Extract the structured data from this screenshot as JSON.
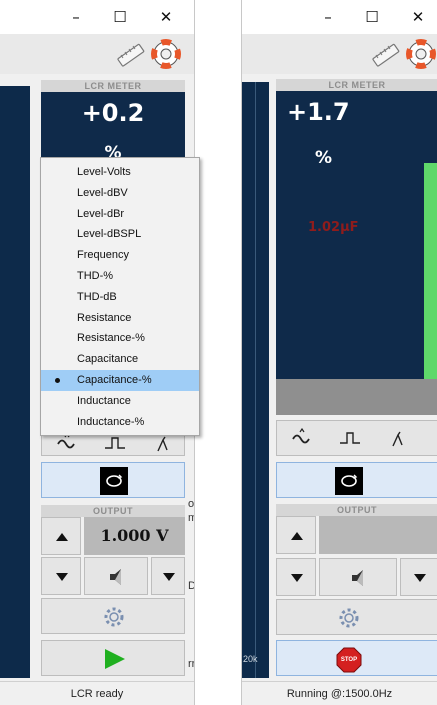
{
  "left_window": {
    "titlebar": {
      "minimize": "–",
      "maximize": "☐",
      "close": "✕"
    },
    "lcr": {
      "header": "LCR METER",
      "reading": "+0.2",
      "unit": "%"
    },
    "mode_menu": {
      "items": [
        "Level-Volts",
        "Level-dBV",
        "Level-dBr",
        "Level-dBSPL",
        "Frequency",
        "THD-%",
        "THD-dB",
        "Resistance",
        "Resistance-%",
        "Capacitance",
        "Capacitance-%",
        "Inductance",
        "Inductance-%"
      ],
      "selected": "Capacitance-%"
    },
    "output": {
      "header": "OUTPUT",
      "value": "1.000 V"
    },
    "behind_text": {
      "t1": "o(",
      "t2": "m",
      "t3": "DI",
      "t4": "rr"
    },
    "status": "LCR ready"
  },
  "right_window": {
    "titlebar": {
      "minimize": "–",
      "maximize": "☐",
      "close": "✕"
    },
    "lcr": {
      "header": "LCR METER",
      "reading": "+1.7",
      "unit": "%",
      "secondary": "1.02µF"
    },
    "output": {
      "header": "OUTPUT"
    },
    "axis_label": "20k",
    "stop_label": "STOP",
    "status": "Running @:1500.0Hz"
  },
  "colors": {
    "display_bg": "#0f2a4a",
    "secondary_red": "#8f1c1c",
    "menu_highlight": "#9fcdf6",
    "play_green": "#20b020",
    "stop_red": "#d42020",
    "green_bar": "#5fd86a"
  },
  "icons": [
    "ruler-icon",
    "lifebuoy-icon",
    "sine-wave-icon",
    "pulse-icon",
    "step-icon",
    "loop-icon",
    "triangle-up-icon",
    "triangle-down-icon",
    "speaker-icon",
    "gear-icon",
    "play-icon",
    "stop-icon"
  ]
}
